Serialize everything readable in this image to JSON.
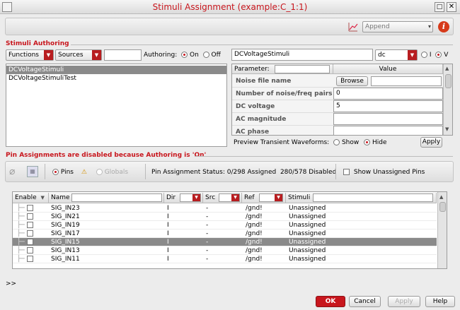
{
  "window": {
    "title": "Stimuli Assignment (example:C_1:1)"
  },
  "toolbar": {
    "mode_value": "Append"
  },
  "authoring": {
    "section_label": "Stimuli Authoring",
    "functions_label": "Functions",
    "sources_label": "Sources",
    "authoring_label": "Authoring:",
    "on_label": "On",
    "off_label": "Off",
    "list": [
      "DCVoltageStimuli",
      "DCVoltageStimuliTest"
    ],
    "selected_stimulus": "DCVoltageStimuli",
    "stimulus_name": "DCVoltageStimuli",
    "stimulus_type": "dc",
    "i_label": "I",
    "v_label": "V"
  },
  "params": {
    "col_parameter": "Parameter:",
    "col_value": "Value",
    "rows": [
      {
        "name": "Noise file name",
        "value": "Browse"
      },
      {
        "name": "Number of noise/freq pairs",
        "value": "0"
      },
      {
        "name": "DC voltage",
        "value": "5"
      },
      {
        "name": "AC magnitude",
        "value": ""
      },
      {
        "name": "AC phase",
        "value": ""
      }
    ]
  },
  "preview": {
    "label": "Preview Transient Waveforms:",
    "show_label": "Show",
    "hide_label": "Hide",
    "apply_label": "Apply"
  },
  "pins": {
    "section_label": "Pin Assignments are disabled because Authoring is 'On'",
    "pins_label": "Pins",
    "globals_label": "Globals",
    "status": "Pin Assignment Status: 0/298 Assigned  280/578 Disabled",
    "show_unassigned_label": "Show Unassigned Pins",
    "columns": {
      "enable": "Enable",
      "name": "Name",
      "dir": "Dir",
      "src": "Src",
      "ref": "Ref",
      "stimuli": "Stimuli"
    },
    "rows": [
      {
        "name": "SIG_IN23",
        "dir": "I",
        "src": "-",
        "ref": "/gnd!",
        "stimuli": "Unassigned"
      },
      {
        "name": "SIG_IN21",
        "dir": "I",
        "src": "-",
        "ref": "/gnd!",
        "stimuli": "Unassigned"
      },
      {
        "name": "SIG_IN19",
        "dir": "I",
        "src": "-",
        "ref": "/gnd!",
        "stimuli": "Unassigned"
      },
      {
        "name": "SIG_IN17",
        "dir": "I",
        "src": "-",
        "ref": "/gnd!",
        "stimuli": "Unassigned"
      },
      {
        "name": "SIG_IN15",
        "dir": "I",
        "src": "-",
        "ref": "/gnd!",
        "stimuli": "Unassigned"
      },
      {
        "name": "SIG_IN13",
        "dir": "I",
        "src": "-",
        "ref": "/gnd!",
        "stimuli": "Unassigned"
      },
      {
        "name": "SIG_IN11",
        "dir": "I",
        "src": "-",
        "ref": "/gnd!",
        "stimuli": "Unassigned"
      }
    ],
    "selected_row": "SIG_IN15"
  },
  "console": {
    "prompt": ">>"
  },
  "buttons": {
    "ok": "OK",
    "cancel": "Cancel",
    "apply": "Apply",
    "help": "Help"
  },
  "colors": {
    "accent": "#c8161d",
    "selection": "#8a8a8a"
  }
}
